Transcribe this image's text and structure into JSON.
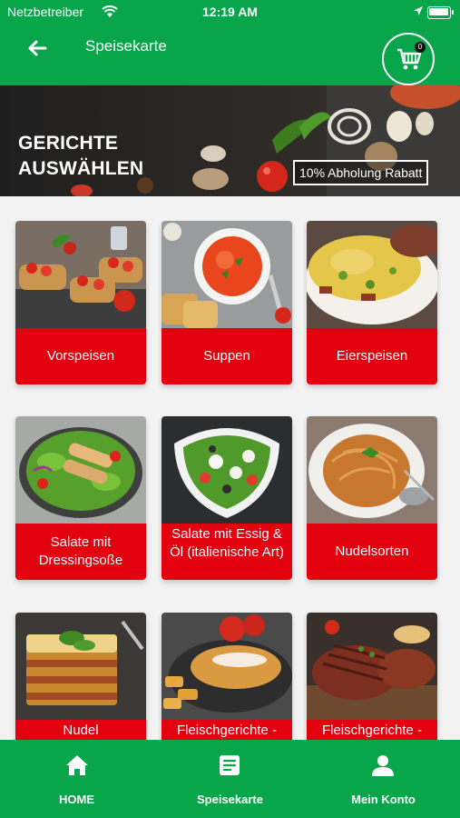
{
  "status": {
    "carrier": "Netzbetreiber",
    "time": "12:19 AM"
  },
  "appbar": {
    "title": "Speisekarte",
    "cart_count": "0"
  },
  "hero": {
    "line1": "GERICHTE",
    "line2": "AUSWÄHLEN",
    "badge": "10% Abholung Rabatt"
  },
  "categories": [
    {
      "label": "Vorspeisen"
    },
    {
      "label": "Suppen"
    },
    {
      "label": "Eierspeisen"
    },
    {
      "label": "Salate mit Dressingsoße"
    },
    {
      "label": "Salate mit Essig & Öl (italienische Art)"
    },
    {
      "label": "Nudelsorten"
    },
    {
      "label": "Nudel"
    },
    {
      "label": "Fleischgerichte -"
    },
    {
      "label": "Fleischgerichte -"
    }
  ],
  "nav": {
    "home": "HOME",
    "menu": "Speisekarte",
    "account": "Mein Konto"
  },
  "colors": {
    "primary": "#08a54a",
    "tile_label": "#e3000f"
  }
}
